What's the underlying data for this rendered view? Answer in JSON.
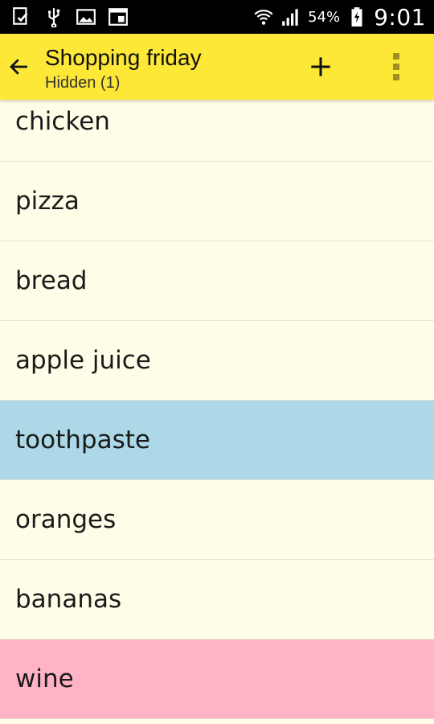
{
  "status_bar": {
    "battery_percent": "54%",
    "time": "9:01",
    "icons": [
      "notification-icon",
      "usb-icon",
      "image-icon",
      "screen-icon",
      "wifi-icon",
      "signal-icon",
      "battery-charging-icon"
    ]
  },
  "app_bar": {
    "title": "Shopping friday",
    "subtitle": "Hidden (1)",
    "back_icon": "arrow-left-icon",
    "add_icon": "plus-icon",
    "menu_icon": "overflow-menu-icon"
  },
  "items": [
    {
      "label": "chicken",
      "color": ""
    },
    {
      "label": "pizza",
      "color": ""
    },
    {
      "label": "bread",
      "color": ""
    },
    {
      "label": "apple juice",
      "color": ""
    },
    {
      "label": "toothpaste",
      "color": "#acd8e7"
    },
    {
      "label": "oranges",
      "color": ""
    },
    {
      "label": "bananas",
      "color": ""
    },
    {
      "label": "wine",
      "color": "#ffb3c4"
    }
  ],
  "colors": {
    "app_bar": "#fde838",
    "background": "#fffde8"
  }
}
